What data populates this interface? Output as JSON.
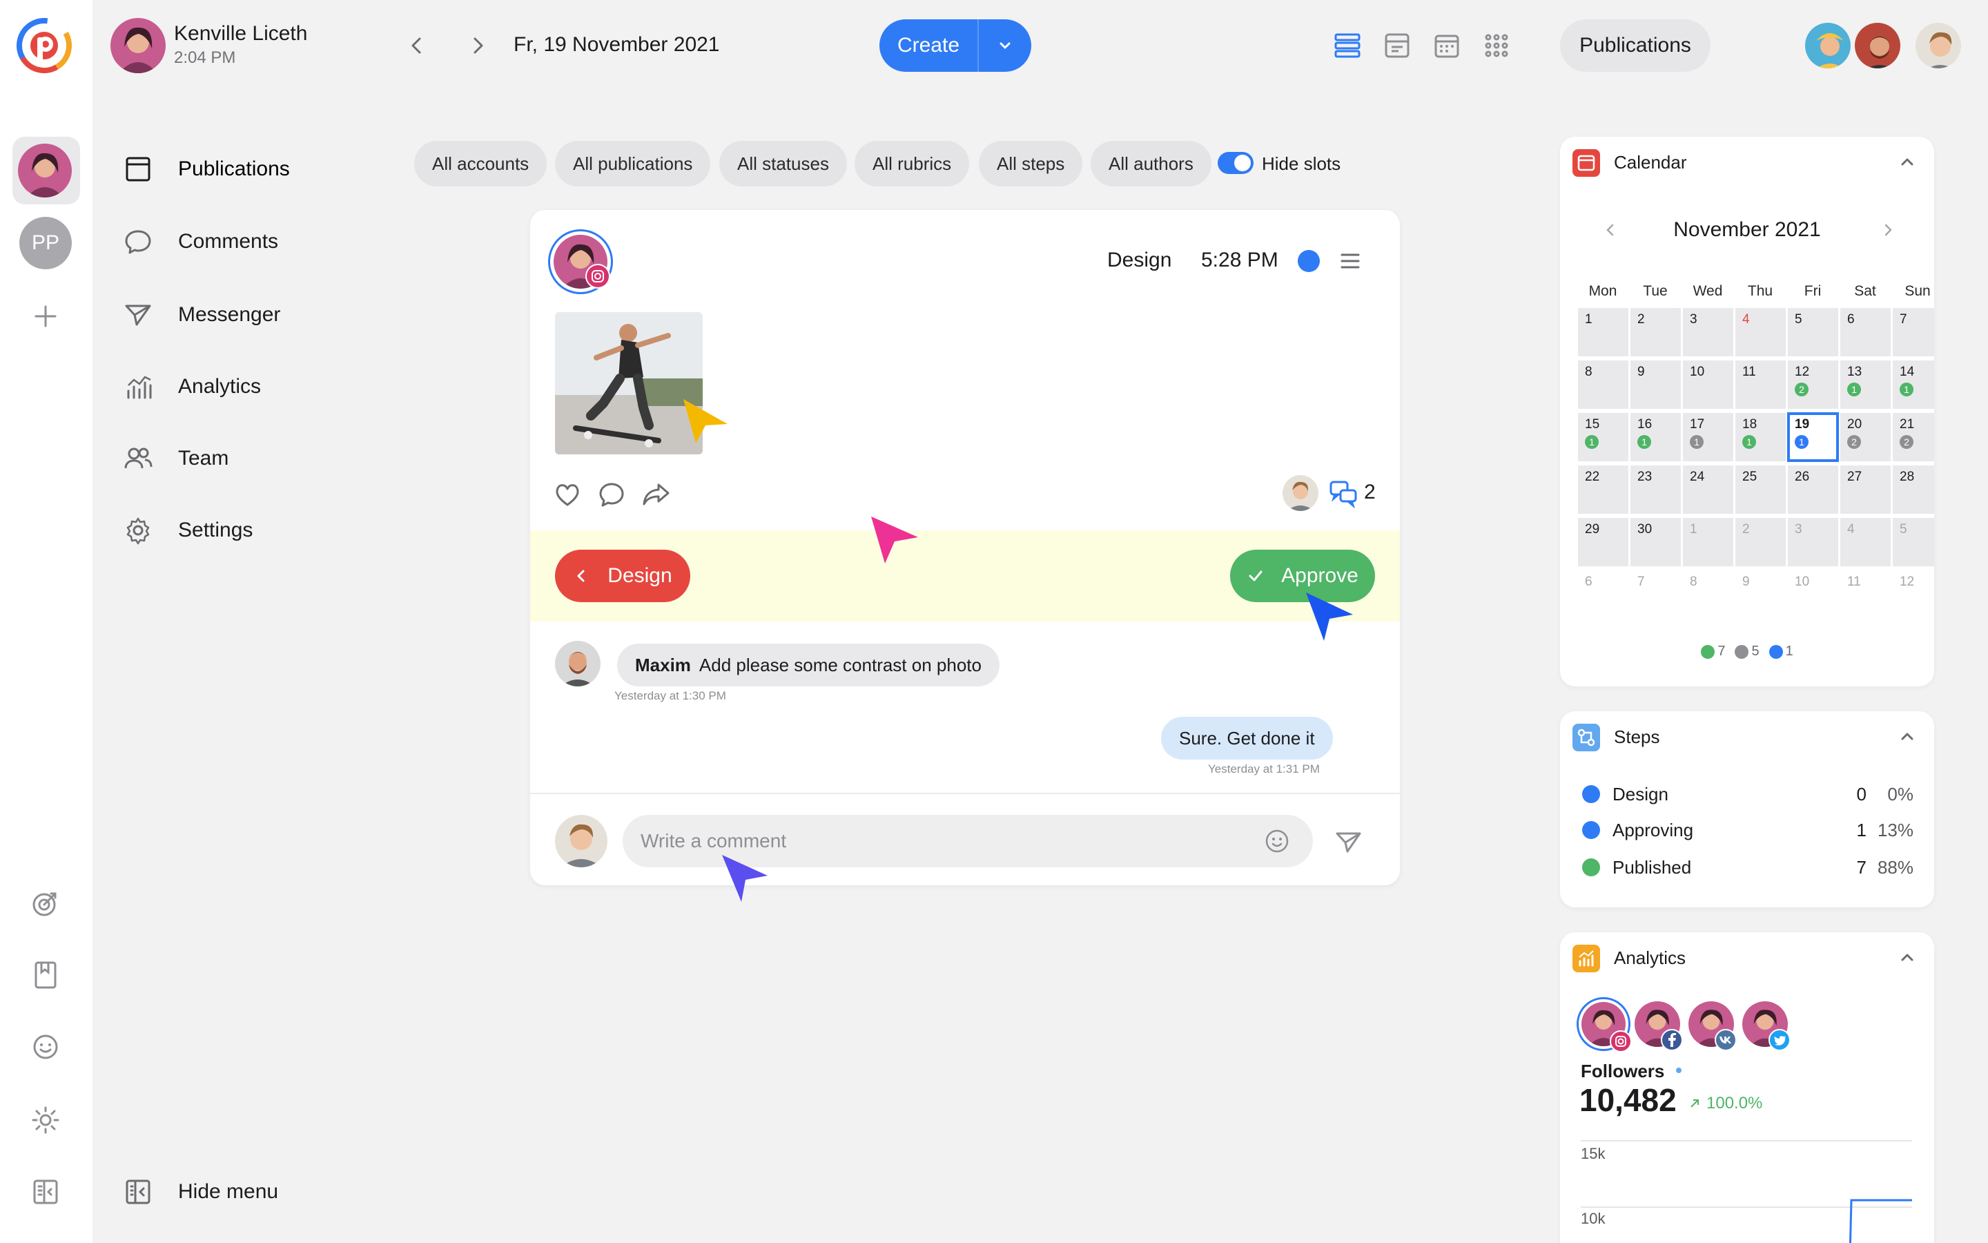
{
  "app": {
    "user_name": "Kenville Liceth",
    "user_time": "2:04 PM",
    "current_date": "Fr, 19 November 2021",
    "create_label": "Create",
    "publications_pill": "Publications",
    "rail_workspace_initials": "PP",
    "colors": {
      "accent": "#2f7bf5",
      "danger": "#e5473f",
      "success": "#4fb567",
      "highlight": "#fdfde0"
    }
  },
  "menu": {
    "items": [
      {
        "label": "Publications",
        "icon": "calendar-square-icon"
      },
      {
        "label": "Comments",
        "icon": "chat-bubble-icon"
      },
      {
        "label": "Messenger",
        "icon": "paper-plane-icon"
      },
      {
        "label": "Analytics",
        "icon": "bar-chart-icon"
      },
      {
        "label": "Team",
        "icon": "team-icon"
      },
      {
        "label": "Settings",
        "icon": "gear-icon"
      }
    ],
    "hide_menu_label": "Hide menu"
  },
  "filters": {
    "items": [
      "All accounts",
      "All publications",
      "All statuses",
      "All rubrics",
      "All steps",
      "All authors"
    ],
    "toggle_label": "Hide slots",
    "toggle_on": true
  },
  "post": {
    "step": "Design",
    "time": "5:28 PM",
    "comment_count": "2",
    "back_button": "Design",
    "approve_button": "Approve",
    "comments": [
      {
        "author": "Maxim",
        "text": "Add please some contrast on photo",
        "time": "Yesterday at 1:30 PM"
      }
    ],
    "reply": {
      "text": "Sure. Get done it",
      "time": "Yesterday at 1:31 PM"
    },
    "input_placeholder": "Write a comment"
  },
  "calendar": {
    "title": "Calendar",
    "month": "November 2021",
    "weekdays": [
      "Mon",
      "Tue",
      "Wed",
      "Thu",
      "Fri",
      "Sat",
      "Sun"
    ],
    "weeks": [
      [
        {
          "d": "1"
        },
        {
          "d": "2"
        },
        {
          "d": "3"
        },
        {
          "d": "4",
          "red": true
        },
        {
          "d": "5"
        },
        {
          "d": "6"
        },
        {
          "d": "7"
        }
      ],
      [
        {
          "d": "8"
        },
        {
          "d": "9"
        },
        {
          "d": "10"
        },
        {
          "d": "11"
        },
        {
          "d": "12",
          "badge": "2",
          "c": "green"
        },
        {
          "d": "13",
          "badge": "1",
          "c": "green"
        },
        {
          "d": "14",
          "badge": "1",
          "c": "green"
        }
      ],
      [
        {
          "d": "15",
          "badge": "1",
          "c": "green"
        },
        {
          "d": "16",
          "badge": "1",
          "c": "green"
        },
        {
          "d": "17",
          "badge": "1",
          "c": "gray"
        },
        {
          "d": "18",
          "badge": "1",
          "c": "green"
        },
        {
          "d": "19",
          "badge": "1",
          "c": "blue",
          "today": true
        },
        {
          "d": "20",
          "badge": "2",
          "c": "gray"
        },
        {
          "d": "21",
          "badge": "2",
          "c": "gray"
        }
      ],
      [
        {
          "d": "22"
        },
        {
          "d": "23"
        },
        {
          "d": "24"
        },
        {
          "d": "25"
        },
        {
          "d": "26"
        },
        {
          "d": "27"
        },
        {
          "d": "28"
        }
      ],
      [
        {
          "d": "29"
        },
        {
          "d": "30"
        },
        {
          "d": "1",
          "muted": true
        },
        {
          "d": "2",
          "muted": true
        },
        {
          "d": "3",
          "muted": true
        },
        {
          "d": "4",
          "muted": true
        },
        {
          "d": "5",
          "muted": true
        }
      ],
      [
        {
          "d": "6",
          "muted": true,
          "empty": true
        },
        {
          "d": "7",
          "muted": true,
          "empty": true
        },
        {
          "d": "8",
          "muted": true,
          "empty": true
        },
        {
          "d": "9",
          "muted": true,
          "empty": true
        },
        {
          "d": "10",
          "muted": true,
          "empty": true
        },
        {
          "d": "11",
          "muted": true,
          "empty": true
        },
        {
          "d": "12",
          "muted": true,
          "empty": true
        }
      ]
    ],
    "legend": [
      {
        "count": "7",
        "color": "#4fb567"
      },
      {
        "count": "5",
        "color": "#8e8e93"
      },
      {
        "count": "1",
        "color": "#2f7bf5"
      }
    ]
  },
  "steps": {
    "title": "Steps",
    "items": [
      {
        "name": "Design",
        "count": "0",
        "percent": "0%",
        "color": "#2f7bf5"
      },
      {
        "name": "Approving",
        "count": "1",
        "percent": "13%",
        "color": "#2f7bf5"
      },
      {
        "name": "Published",
        "count": "7",
        "percent": "88%",
        "color": "#4fb567"
      }
    ]
  },
  "analytics": {
    "title": "Analytics",
    "networks": [
      "instagram",
      "facebook",
      "vk",
      "twitter"
    ],
    "metric_label": "Followers",
    "metric_value": "10,482",
    "metric_change": "100.0%",
    "y_ticks": [
      "15k",
      "10k"
    ]
  }
}
